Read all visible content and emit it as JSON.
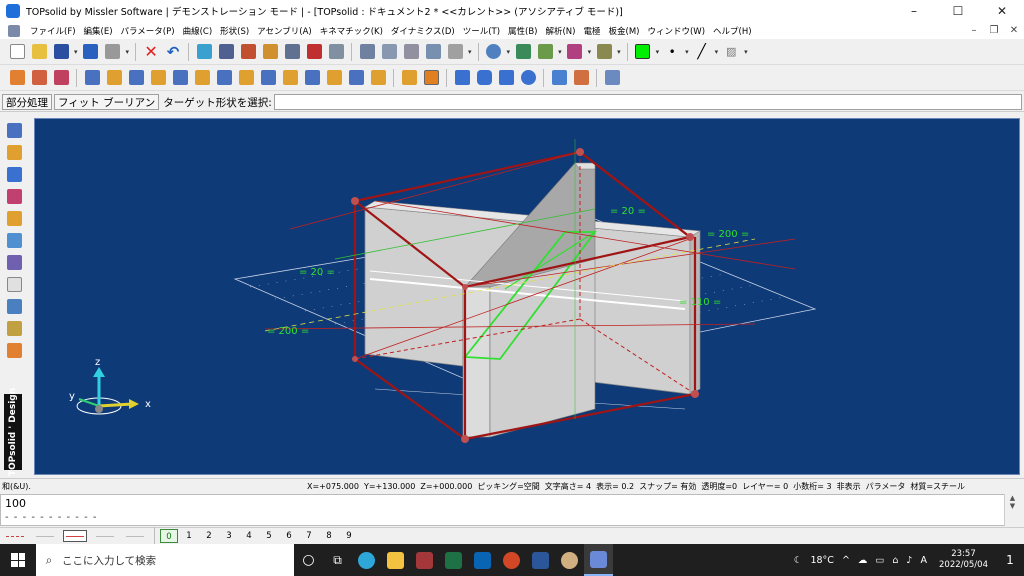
{
  "window": {
    "title": "TOPsolid by Missler Software | デモンストレーション モード | - [TOPsolid : ドキュメント2 *  <<カレント>> (アソシアティブ モード)]",
    "controls": [
      "–",
      "☐",
      "✕"
    ]
  },
  "menu": {
    "items": [
      "ファイル(F)",
      "編集(E)",
      "パラメータ(P)",
      "曲線(C)",
      "形状(S)",
      "アセンブリ(A)",
      "キネマチック(K)",
      "ダイナミクス(D)",
      "ツール(T)",
      "属性(B)",
      "解析(N)",
      "電極",
      "板金(M)",
      "ウィンドウ(W)",
      "ヘルプ(H)"
    ],
    "mdi_controls": [
      "–",
      "❐",
      "✕"
    ]
  },
  "command_bar": {
    "buttons": [
      "部分処理",
      "フィット ブーリアン"
    ],
    "prompt": "ターゲット形状を選択:",
    "input_value": ""
  },
  "brand": {
    "label": "TOPsolid ' Design"
  },
  "viewport": {
    "dimension_labels": [
      "= 20 =",
      "= 200 =",
      "= 20 =",
      "= 200 =",
      "= 110 ="
    ],
    "axes": {
      "x": "x",
      "y": "y",
      "z": "z"
    },
    "colors": {
      "background": "#0e3a78",
      "selection": "#a01414",
      "grid": "#c8d2e6",
      "solid_face": "#d8d8d8"
    }
  },
  "status": {
    "hint": "和(&U).",
    "fields": [
      "X=+075.000",
      "Y=+130.000",
      "Z=+000.000",
      "ピッキング=空間",
      "文字高さ= 4",
      "表示=  0.2",
      "スナップ= 有効",
      "透明度=0",
      "レイヤー= 0",
      "小数桁= 3",
      "非表示",
      "パラメータ",
      "材質=スチール"
    ]
  },
  "text_output": {
    "value": "100",
    "dashes": "- - - - - - - - - - -"
  },
  "layers": [
    "0",
    "1",
    "2",
    "3",
    "4",
    "5",
    "6",
    "7",
    "8",
    "9"
  ],
  "taskbar": {
    "search_placeholder": "ここに入力して検索",
    "weather": "18°C",
    "ime": "A",
    "time": "23:57",
    "date": "2022/05/04",
    "notification_count": "1"
  }
}
